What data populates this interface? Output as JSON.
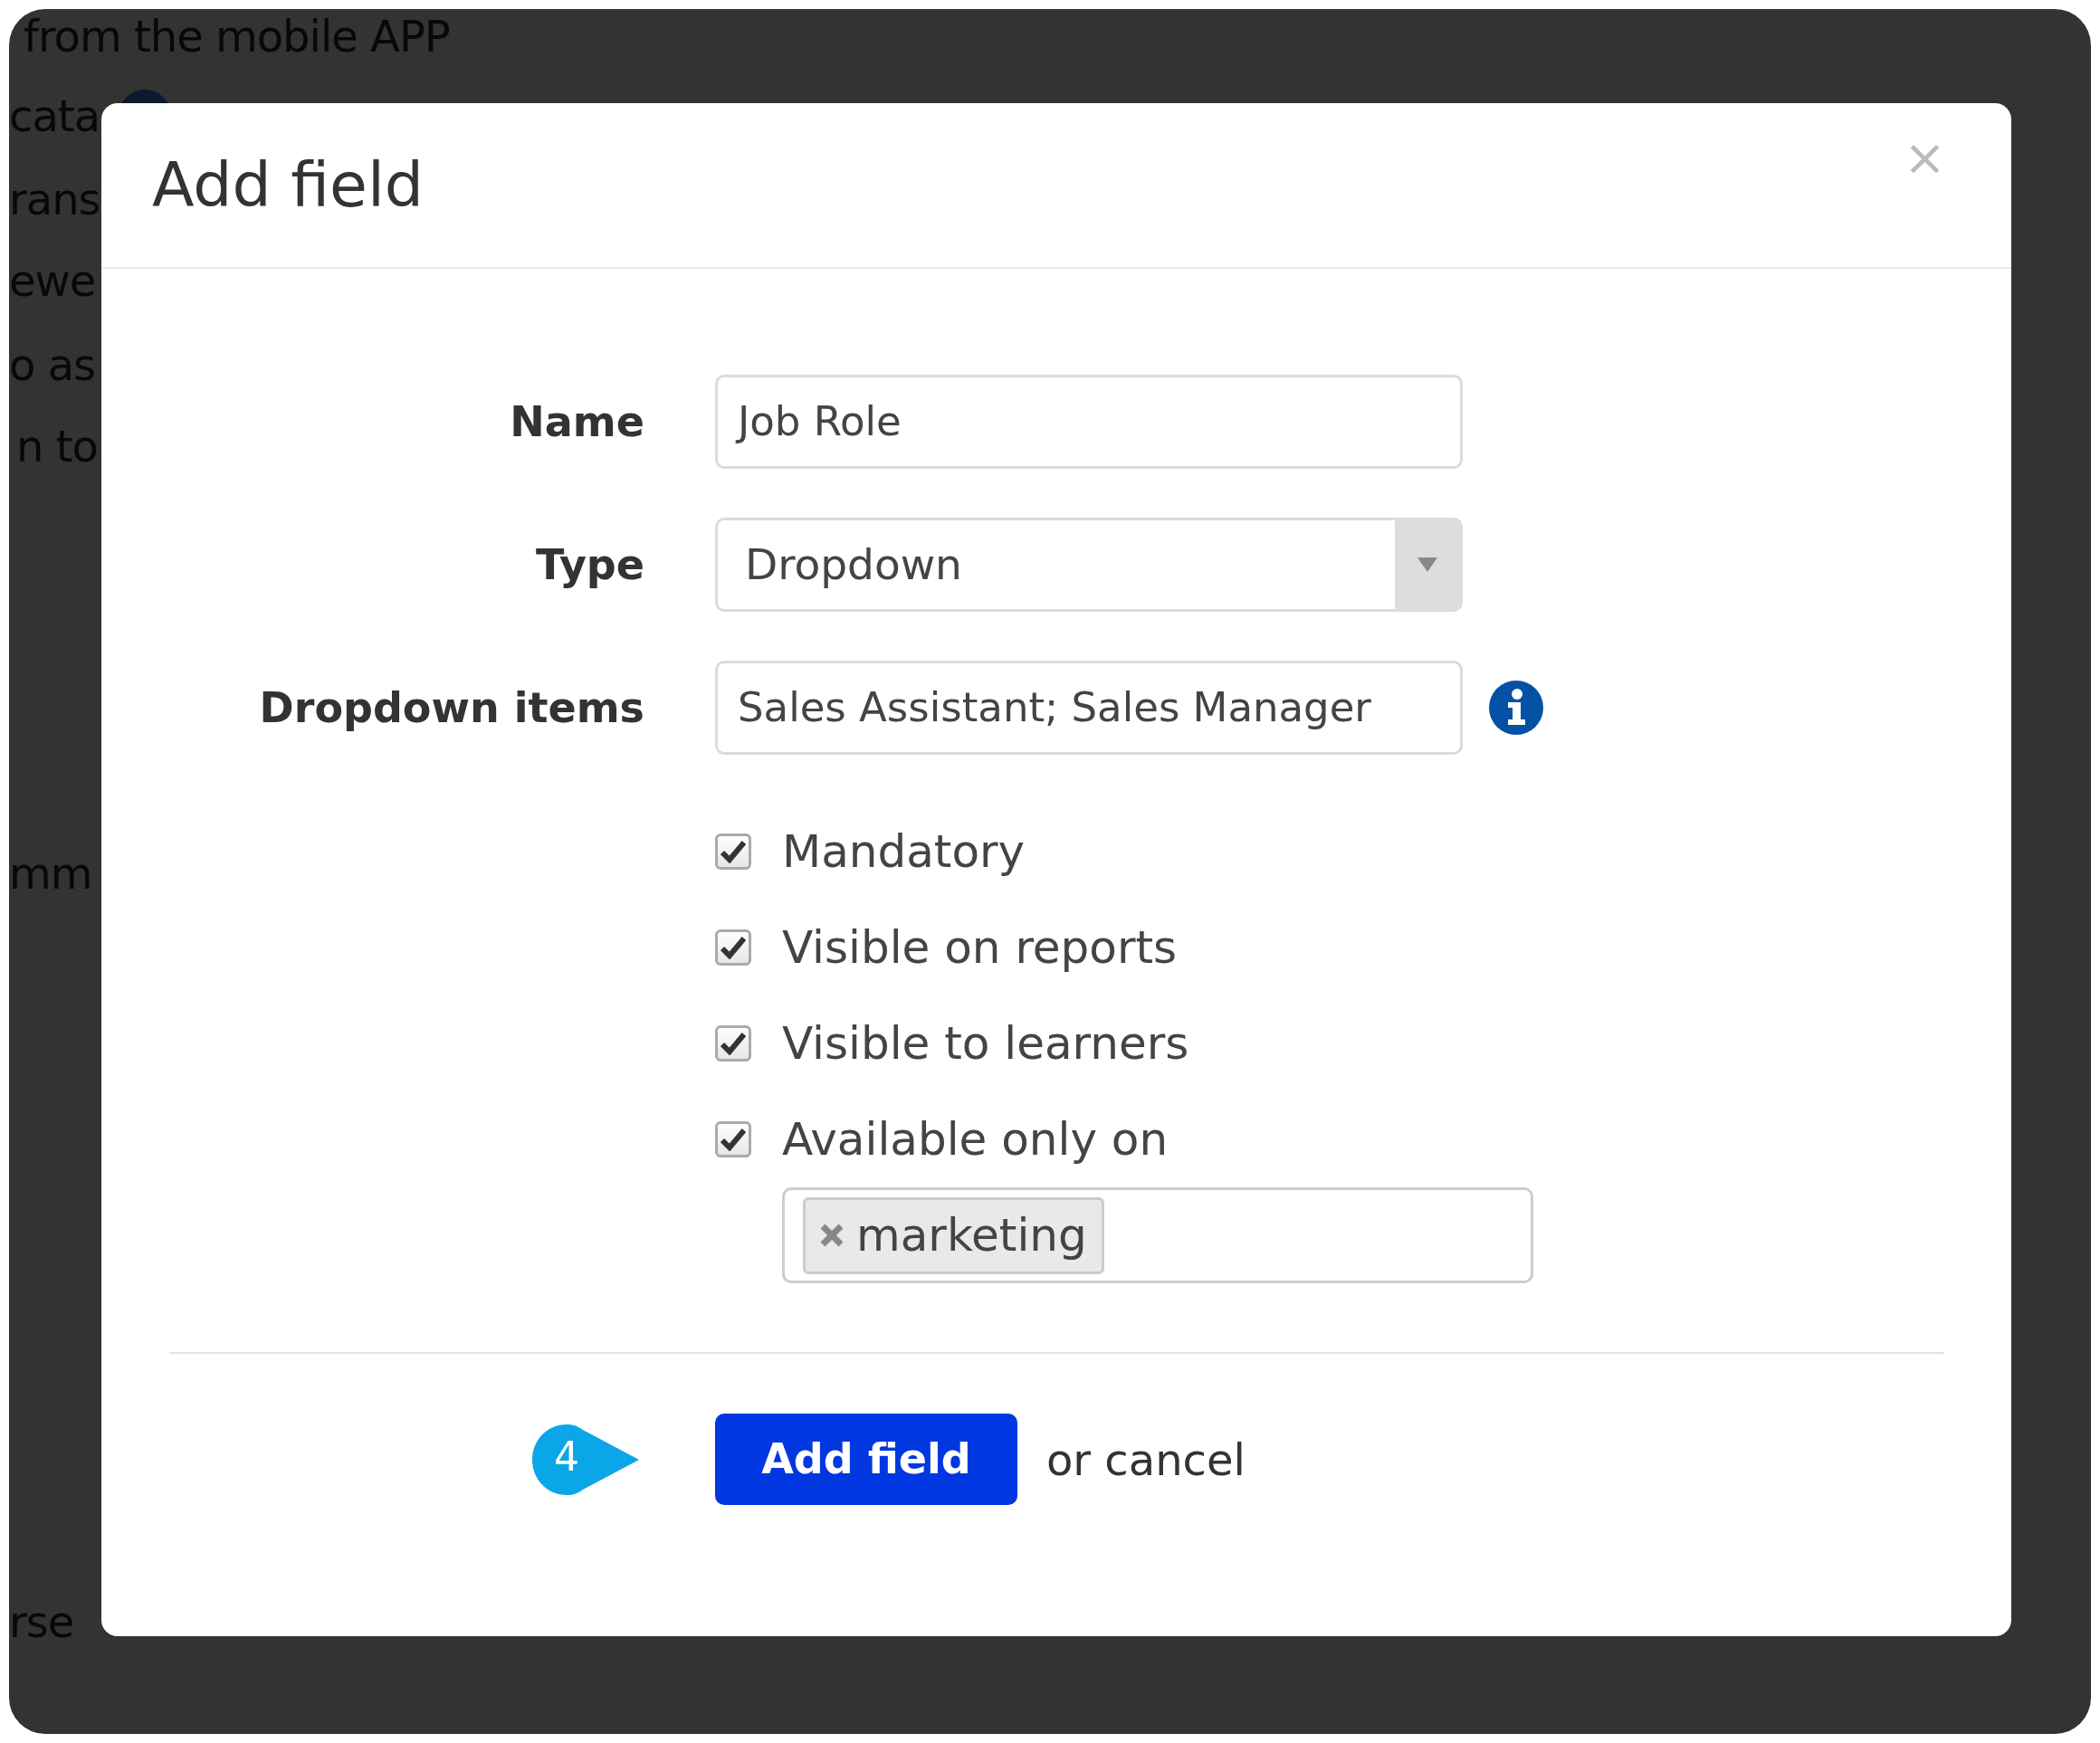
{
  "background": {
    "lines": [
      "from the mobile APP",
      "cata",
      "rans",
      "ewe",
      "o as",
      "n to",
      "mm",
      "rse"
    ]
  },
  "modal": {
    "title": "Add field",
    "close": "×",
    "fields": [
      {
        "kind": "text",
        "label": "Name",
        "value": "Job Role",
        "info": false
      },
      {
        "kind": "select",
        "label": "Type",
        "value": "Dropdown",
        "info": false
      },
      {
        "kind": "text",
        "label": "Dropdown items",
        "value": "Sales Assistant; Sales Manager",
        "info": true
      }
    ],
    "options": [
      {
        "label": "Mandatory",
        "checked": true
      },
      {
        "label": "Visible on reports",
        "checked": true
      },
      {
        "label": "Visible to learners",
        "checked": true
      },
      {
        "label": "Available only on",
        "checked": true
      }
    ],
    "tags": [
      "marketing"
    ],
    "submit": "Add field",
    "cancel": "or cancel",
    "step": "4"
  }
}
